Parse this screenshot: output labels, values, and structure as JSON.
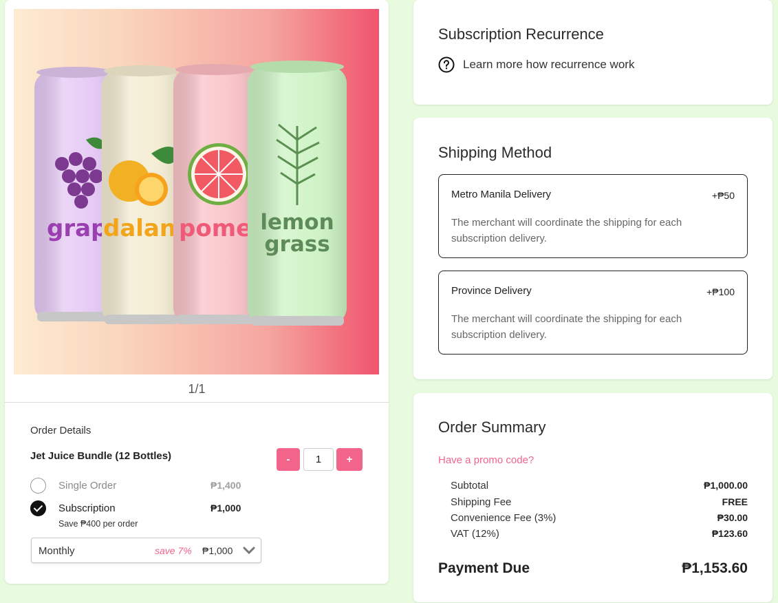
{
  "product": {
    "can_labels": [
      "grap",
      "daland",
      "pomel",
      "lemon",
      "grass"
    ],
    "pager": "1/1"
  },
  "order": {
    "section_label": "Order Details",
    "bundle_name": "Jet Juice Bundle (12 Bottles)",
    "quantity": "1",
    "qty_minus": "-",
    "qty_plus": "+",
    "options": [
      {
        "label": "Single Order",
        "price": "₱1,400",
        "selected": false
      },
      {
        "label": "Subscription",
        "price": "₱1,000",
        "selected": true
      }
    ],
    "save_note": "Save ₱400 per order",
    "frequency": {
      "label": "Monthly",
      "save": "save 7%",
      "price": "₱1,000"
    }
  },
  "recurrence": {
    "title": "Subscription Recurrence",
    "learn_more": "Learn more how recurrence work"
  },
  "shipping": {
    "title": "Shipping Method",
    "options": [
      {
        "name": "Metro Manila Delivery",
        "fee": "+₱50",
        "description": "The merchant will coordinate the shipping for each subscription delivery."
      },
      {
        "name": "Province Delivery",
        "fee": "+₱100",
        "description": "The merchant will coordinate the shipping for each subscription delivery."
      }
    ]
  },
  "summary": {
    "title": "Order Summary",
    "promo": "Have a promo code?",
    "rows": [
      {
        "label": "Subtotal",
        "value": "₱1,000.00"
      },
      {
        "label": "Shipping Fee",
        "value": "FREE"
      },
      {
        "label": "Convenience Fee (3%)",
        "value": "₱30.00"
      },
      {
        "label": "VAT (12%)",
        "value": "₱123.60"
      }
    ],
    "due_label": "Payment Due",
    "due_value": "₱1,153.60"
  },
  "colors": {
    "background": "#e8fbdf",
    "accent": "#f2648a",
    "can_colors": [
      "#e5c9f4",
      "#f3ecd2",
      "#f9c3c8",
      "#cdf3c4"
    ]
  }
}
